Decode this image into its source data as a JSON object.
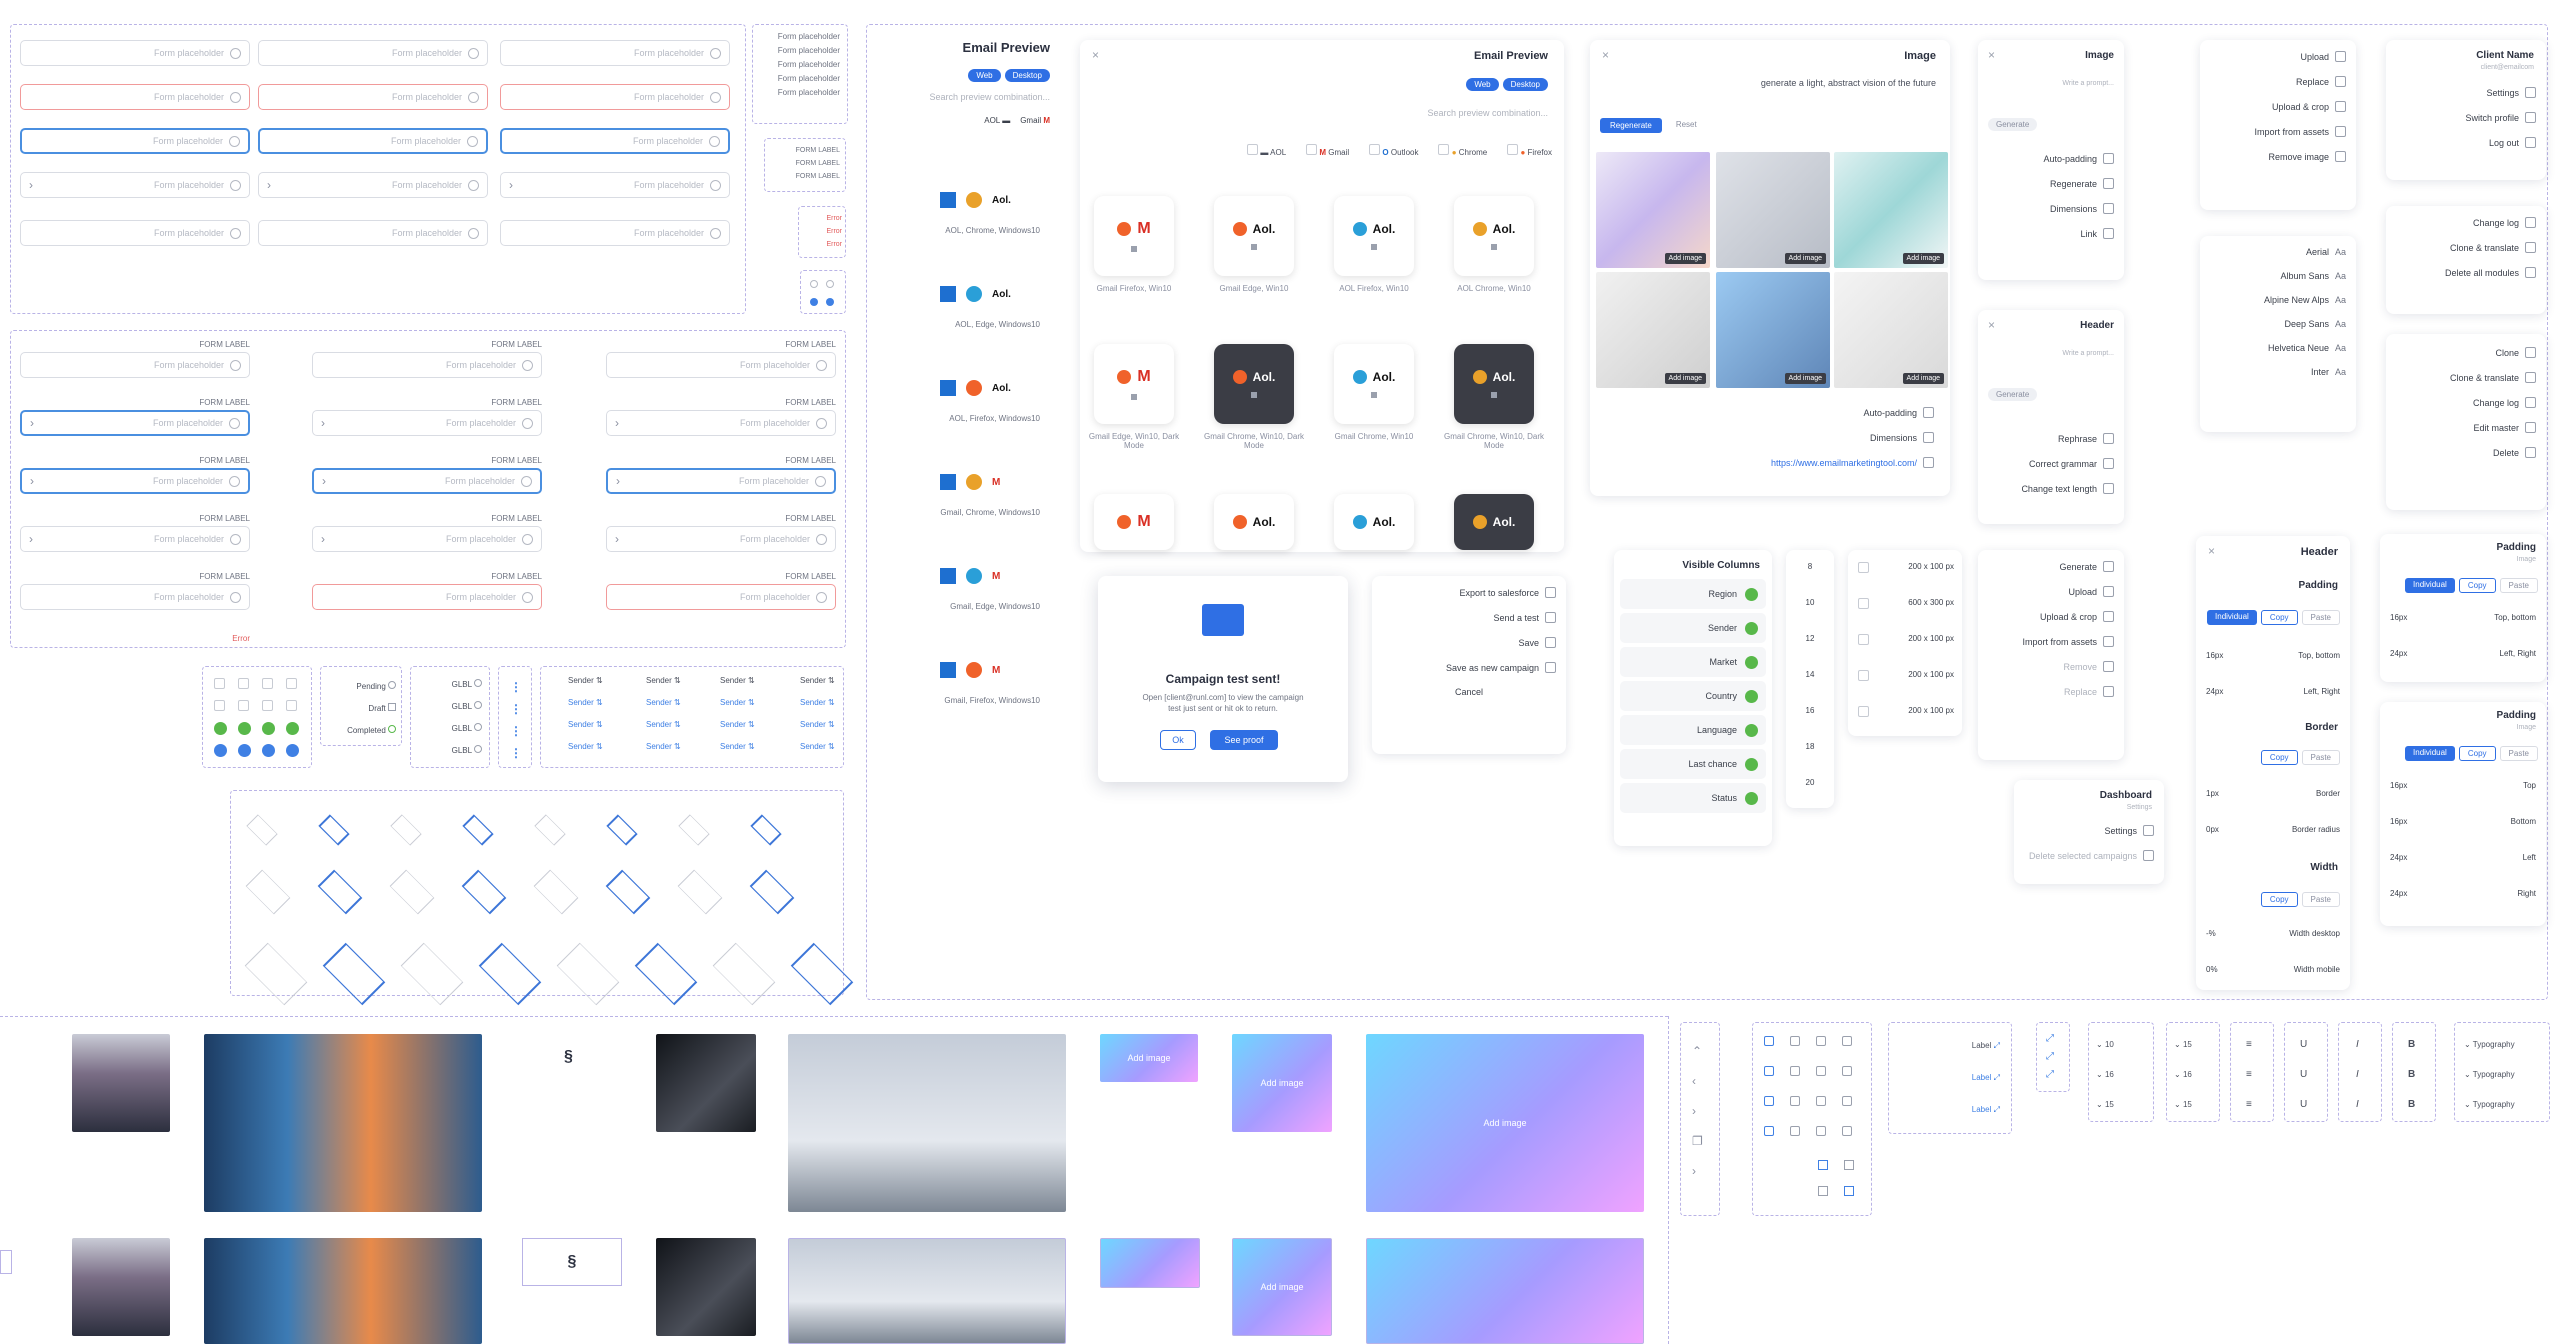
{
  "forms": {
    "placeholder": "Form placeholder",
    "label": "FORM LABEL",
    "error": "Error",
    "list_items": [
      "Form placeholder",
      "Form placeholder",
      "Form placeholder",
      "Form placeholder",
      "Form placeholder"
    ],
    "form_labels": [
      "FORM LABEL",
      "FORM LABEL",
      "FORM LABEL"
    ],
    "errors": [
      "Error",
      "Error",
      "Error"
    ]
  },
  "status_legend": [
    "Pending",
    "Draft",
    "Completed"
  ],
  "gbl_items": [
    "GLBL",
    "GLBL",
    "GLBL",
    "GLBL"
  ],
  "sender_label": "Sender",
  "email_preview": {
    "title": "Email Preview",
    "tabs": [
      "Web",
      "Desktop"
    ],
    "search_placeholder": "Search preview combination...",
    "clients": [
      "Gmail",
      "AOL",
      "Outlook",
      "Chrome",
      "Firefox"
    ],
    "list_labels": [
      "AOL, Chrome, Windows10",
      "AOL, Edge, Windows10",
      "AOL, Firefox, Windows10",
      "Gmail, Chrome, Windows10",
      "Gmail, Edge, Windows10",
      "Gmail, Firefox, Windows10"
    ],
    "tiles": [
      "AOL Chrome, Win10",
      "AOL Edge, Win10",
      "AOL Firefox, Win10",
      "Gmail Chrome, Win10",
      "Gmail Chrome, Win10, Dark Mode",
      "Gmail Edge, Win10",
      "Gmail Edge, Win10, Dark Mode",
      "Gmail Firefox, Win10"
    ]
  },
  "image_panel": {
    "title": "Image",
    "prompt": "generate a light, abstract vision of the future",
    "tabs": [
      "Regenerate",
      "Reset"
    ],
    "add_image": "Add image",
    "options": [
      "Auto-padding",
      "Dimensions"
    ],
    "link": "https://www.emailmarketingtool.com/"
  },
  "image_menu": {
    "title": "Image",
    "prompt_placeholder": "Write a prompt...",
    "generate": "Generate",
    "items": [
      "Auto-padding",
      "Regenerate",
      "Dimensions",
      "Link"
    ]
  },
  "header_menu": {
    "title": "Header",
    "prompt_placeholder": "Write a prompt...",
    "generate": "Generate",
    "items": [
      "Rephrase",
      "Correct grammar",
      "Change text length"
    ]
  },
  "upload_menu": [
    "Upload",
    "Replace",
    "Upload & crop",
    "Import from assets",
    "Remove image"
  ],
  "upload_menu2": [
    "Generate",
    "Upload",
    "Upload & crop",
    "Import from assets",
    "Remove",
    "Replace"
  ],
  "client_menu": {
    "name": "Client Name",
    "sub": "client@emailcom",
    "items": [
      "Settings",
      "Switch profile",
      "Log out"
    ]
  },
  "change_menu": [
    "Change log",
    "Clone & translate",
    "Delete all modules"
  ],
  "fonts": [
    "Aerial",
    "Album Sans",
    "Alpine New Alps",
    "Deep Sans",
    "Helvetica Neue",
    "Inter"
  ],
  "clone_menu": [
    "Clone",
    "Clone & translate",
    "Change log",
    "Edit master",
    "Delete"
  ],
  "dashboard": {
    "title": "Dashboard",
    "sub": "Settings",
    "items": [
      "Settings",
      "Delete selected campaigns"
    ]
  },
  "modal": {
    "title": "Campaign test sent!",
    "body": "Open [client@runl.com] to view the campaign test just sent or hit ok to return.",
    "ok": "Ok",
    "see": "See proof"
  },
  "export_menu": [
    "Export to salesforce",
    "Send a test",
    "Save",
    "Save as new campaign",
    "Cancel"
  ],
  "visible_columns": {
    "title": "Visible Columns",
    "items": [
      "Region",
      "Sender",
      "Market",
      "Country",
      "Language",
      "Last chance",
      "Status"
    ]
  },
  "numbers": [
    "8",
    "10",
    "12",
    "14",
    "16",
    "18",
    "20"
  ],
  "sizes": [
    "200 x 100 px",
    "600 x 300 px",
    "200 x 100 px",
    "200 x 100 px",
    "200 x 100 px"
  ],
  "header_panel": {
    "title": "Header",
    "padding": "Padding",
    "border": "Border",
    "width": "Width",
    "paste": "Paste",
    "copy": "Copy",
    "individual": "Individual",
    "rows": [
      "Top, bottom",
      "Left, Right"
    ],
    "border_rows": [
      "Border",
      "Border radius"
    ],
    "width_rows": [
      "Width desktop",
      "Width mobile"
    ],
    "vals": [
      "16px",
      "24px"
    ],
    "border_vals": [
      "1px",
      "0px"
    ],
    "width_vals": [
      "-%",
      "0%"
    ]
  },
  "padding_panel1": {
    "title": "Padding",
    "sub": "Image",
    "paste": "Paste",
    "copy": "Copy",
    "individual": "Individual",
    "rows": [
      "Top, bottom",
      "Left, Right"
    ],
    "vals": [
      "16px",
      "24px"
    ]
  },
  "padding_panel2": {
    "title": "Padding",
    "sub": "Image",
    "paste": "Paste",
    "copy": "Copy",
    "individual": "Individual",
    "rows": [
      "Top",
      "Bottom",
      "Left",
      "Right"
    ],
    "vals": [
      "16px",
      "16px",
      "24px",
      "24px"
    ]
  },
  "gradients": {
    "add": "Add image"
  },
  "labels": [
    "Label",
    "Label",
    "Label"
  ],
  "font_sizes": [
    "10",
    "16",
    "15"
  ],
  "font_sizes2": [
    "15",
    "16",
    "15"
  ],
  "typography": [
    "Typography",
    "Typography",
    "Typography"
  ]
}
